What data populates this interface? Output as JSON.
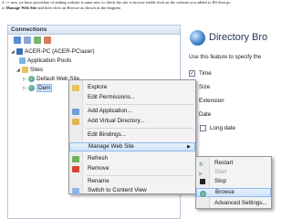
{
  "caption": {
    "line1": "2.<= now we have procedure of adding website it same new to check the site is browse width click on the website you added to IIS then go",
    "line2_prefix": "to",
    "line2_bold": "Manage Web Site",
    "line2_suffix": "and then click on Browse as shown in the diagram"
  },
  "connections": {
    "title": "Connections",
    "tree": {
      "server": "ACER-PC (ACER-PC\\acer)",
      "app_pools": "Application Pools",
      "sites": "Sites",
      "default_site": "Default Web Site",
      "demo_site": "Dem"
    }
  },
  "context_menu": {
    "items": [
      {
        "label": "Explore"
      },
      {
        "label": "Edit Permissions..."
      },
      {
        "label": "Add Application..."
      },
      {
        "label": "Add Virtual Directory..."
      },
      {
        "label": "Edit Bindings..."
      },
      {
        "label": "Manage Web Site"
      },
      {
        "label": "Refresh"
      },
      {
        "label": "Remove"
      },
      {
        "label": "Rename"
      },
      {
        "label": "Switch to Content View"
      }
    ]
  },
  "submenu": {
    "items": [
      {
        "label": "Restart"
      },
      {
        "label": "Start"
      },
      {
        "label": "Stop"
      },
      {
        "label": "Browse"
      },
      {
        "label": "Advanced Settings..."
      }
    ]
  },
  "directory_pane": {
    "title": "Directory Bro",
    "description": "Use this feature to specify the",
    "checkboxes": [
      {
        "label": "Time",
        "checked": true
      },
      {
        "label": "Size",
        "checked": true
      },
      {
        "label": "Extension",
        "checked": true
      },
      {
        "label": "Date",
        "checked": true
      },
      {
        "label": "Long date",
        "checked": false
      }
    ]
  },
  "colors": {
    "highlight": "#cfe3fa",
    "menu_bg": "#f3f3f3",
    "title_text": "#1f3354"
  }
}
